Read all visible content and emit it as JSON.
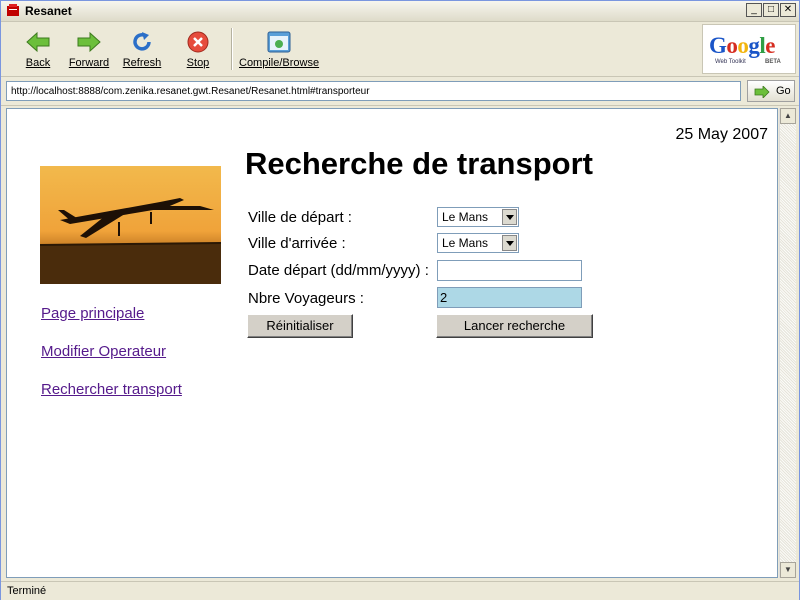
{
  "window": {
    "title": "Resanet"
  },
  "toolbar": {
    "back_label": "Back",
    "forward_label": "Forward",
    "refresh_label": "Refresh",
    "stop_label": "Stop",
    "compile_label": "Compile/Browse"
  },
  "logo": {
    "text": "Google",
    "sub": "Web Toolkit",
    "badge": "BETA"
  },
  "address": {
    "url": "http://localhost:8888/com.zenika.resanet.gwt.Resanet/Resanet.html#transporteur",
    "go_label": "Go"
  },
  "page": {
    "date": "25 May 2007",
    "title": "Recherche de transport",
    "nav": [
      {
        "label": "Page principale"
      },
      {
        "label": "Modifier Operateur"
      },
      {
        "label": "Rechercher transport"
      }
    ],
    "form": {
      "departure_label": "Ville de départ :",
      "departure_value": "Le Mans",
      "arrival_label": "Ville d'arrivée :",
      "arrival_value": "Le Mans",
      "date_label": "Date départ (dd/mm/yyyy) :",
      "date_value": "",
      "travelers_label": "Nbre Voyageurs :",
      "travelers_value": "2",
      "reset_label": "Réinitialiser",
      "search_label": "Lancer recherche"
    }
  },
  "status": {
    "text": "Terminé"
  },
  "colors": {
    "active_input_bg": "#add8e6",
    "link": "#551a8b"
  }
}
